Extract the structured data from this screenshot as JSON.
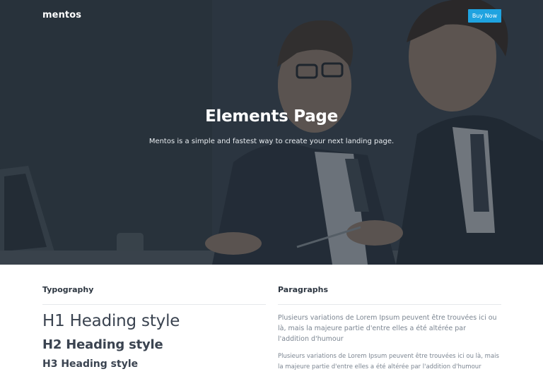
{
  "navbar": {
    "brand": "mentos",
    "cta_label": "Buy Now",
    "cta_color": "#1fa3e0"
  },
  "hero": {
    "title": "Elements Page",
    "subtitle": "Mentos is a simple and fastest way to create your next landing page."
  },
  "typography": {
    "heading": "Typography",
    "h1": "H1 Heading style",
    "h2": "H2 Heading style",
    "h3": "H3 Heading style"
  },
  "paragraphs": {
    "heading": "Paragraphs",
    "items": [
      "Plusieurs variations de Lorem Ipsum peuvent être trouvées ici ou là, mais la majeure partie d'entre elles a été altérée par l'addition d'humour",
      "Plusieurs variations de Lorem Ipsum peuvent être trouvées ici ou là, mais la majeure partie d'entre elles a été altérée par l'addition d'humour"
    ]
  }
}
